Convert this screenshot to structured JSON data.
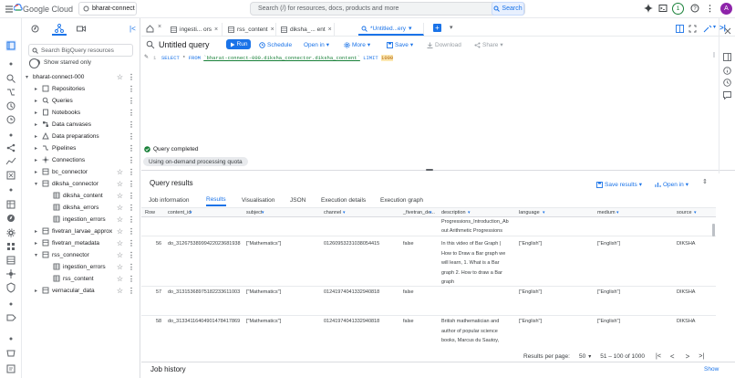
{
  "topbar": {
    "logo": "Google Cloud",
    "project": "bharat-connect",
    "search_placeholder": "Search (/) for resources, docs, products and more",
    "search_button": "Search",
    "notification_count": "1",
    "avatar_letter": "A"
  },
  "explorer": {
    "search_placeholder": "Search BigQuery resources",
    "starred_label": "Show starred only",
    "project": "bharat-connect-000",
    "items": [
      {
        "label": "Repositories"
      },
      {
        "label": "Queries"
      },
      {
        "label": "Notebooks"
      },
      {
        "label": "Data canvases"
      },
      {
        "label": "Data preparations"
      },
      {
        "label": "Pipelines"
      },
      {
        "label": "Connections"
      },
      {
        "label": "bc_connector"
      },
      {
        "label": "diksha_connector"
      },
      {
        "label": "diksha_content"
      },
      {
        "label": "diksha_errors"
      },
      {
        "label": "ingestion_errors"
      },
      {
        "label": "fivetran_larvae_approx"
      },
      {
        "label": "fivetran_metadata"
      },
      {
        "label": "rss_connector"
      },
      {
        "label": "ingestion_errors"
      },
      {
        "label": "rss_content"
      },
      {
        "label": "vernacular_data"
      }
    ]
  },
  "tabs": [
    {
      "label": "ingesti... ors"
    },
    {
      "label": "rss_content"
    },
    {
      "label": "diksha_... ent"
    },
    {
      "label": "*Untitled...ery"
    }
  ],
  "editor": {
    "title": "Untitled query",
    "run": "Run",
    "schedule": "Schedule",
    "open_in": "Open in",
    "more": "More",
    "save": "Save",
    "download": "Download",
    "share": "Share",
    "line_no": "1",
    "sql_select": "SELECT",
    "sql_star": " * ",
    "sql_from": "FROM",
    "sql_table": "`bharat-connect-000.diksha_connector.diksha_content`",
    "sql_limit": "LIMIT",
    "sql_limit_value": "1000"
  },
  "status": {
    "message": "Query completed",
    "quota": "Using on-demand processing quota"
  },
  "results": {
    "title": "Query results",
    "save_results": "Save results",
    "open_in": "Open in",
    "tabs": [
      "Job information",
      "Results",
      "Visualisation",
      "JSON",
      "Execution details",
      "Execution graph"
    ],
    "columns": [
      "Row",
      "content_id",
      "subject",
      "channel",
      "_fivetran_de...",
      "description",
      "language",
      "medium",
      "source"
    ],
    "partial_row": {
      "desc1": "Progressions_Introduction_Ab",
      "desc2": "out Arithmetic Progressions"
    },
    "rows": [
      {
        "row": "56",
        "content_id": "do_31267538999422023681938",
        "subject": "[\"Mathematics\"]",
        "channel": "01260953231038054415",
        "fivetran": "false",
        "description": "In this video of Bar Graph | How to Draw a Bar graph we will learn, 1. What is a Bar graph 2. How to draw a Bar graph",
        "language": "[\"English\"]",
        "medium": "[\"English\"]",
        "source": "DIKSHA"
      },
      {
        "row": "57",
        "content_id": "do_31315368975182233611003",
        "subject": "[\"Mathematics\"]",
        "channel": "01241974041332940818",
        "fivetran": "false",
        "description": "",
        "language": "[\"English\"]",
        "medium": "[\"English\"]",
        "source": "DIKSHA"
      },
      {
        "row": "58",
        "content_id": "do_31334116404901478417869",
        "subject": "[\"Mathematics\"]",
        "channel": "01241974041332940818",
        "fivetran": "false",
        "description": "British mathematician and author of popular science books, Marcus du Sautoy,",
        "language": "[\"English\"]",
        "medium": "[\"English\"]",
        "source": "DIKSHA"
      }
    ],
    "pager": {
      "rows_per_page_label": "Results per page:",
      "rows_per_page": "50",
      "range": "51 – 100 of 1000"
    }
  },
  "job_history": {
    "title": "Job history",
    "show": "Show"
  },
  "colors": {
    "accent": "#1a73e8",
    "status_ok": "#188038"
  }
}
